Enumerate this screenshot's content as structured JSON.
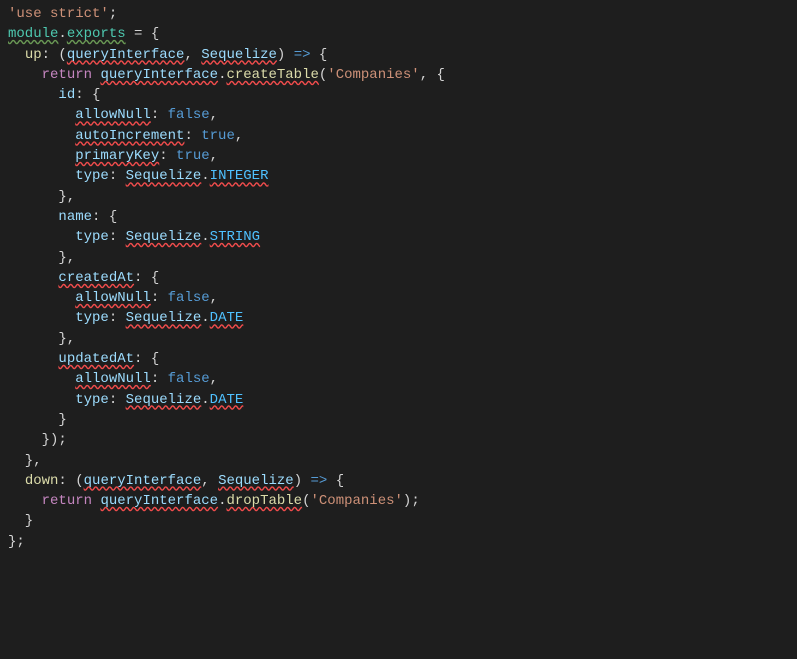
{
  "code": {
    "lines": [
      {
        "tokens": [
          {
            "cls": "string",
            "txt": "'use strict'"
          },
          {
            "cls": "punct",
            "txt": ";"
          }
        ]
      },
      {
        "tokens": [
          {
            "cls": "keyword-export squiggle-green",
            "txt": "module"
          },
          {
            "cls": "punct",
            "txt": "."
          },
          {
            "cls": "keyword-export squiggle-green",
            "txt": "exports"
          },
          {
            "cls": "punct",
            "txt": " = {"
          }
        ]
      },
      {
        "tokens": [
          {
            "cls": "punct",
            "txt": "  "
          },
          {
            "cls": "method",
            "txt": "up"
          },
          {
            "cls": "punct",
            "txt": ": ("
          },
          {
            "cls": "param squiggle-red",
            "txt": "queryInterface"
          },
          {
            "cls": "punct",
            "txt": ", "
          },
          {
            "cls": "param squiggle-red",
            "txt": "Sequelize"
          },
          {
            "cls": "punct",
            "txt": ") "
          },
          {
            "cls": "literal",
            "txt": "=>"
          },
          {
            "cls": "punct",
            "txt": " {"
          }
        ]
      },
      {
        "tokens": [
          {
            "cls": "punct",
            "txt": "    "
          },
          {
            "cls": "keyword-return",
            "txt": "return"
          },
          {
            "cls": "punct",
            "txt": " "
          },
          {
            "cls": "param squiggle-red",
            "txt": "queryInterface"
          },
          {
            "cls": "punct",
            "txt": "."
          },
          {
            "cls": "method squiggle-red",
            "txt": "createTable"
          },
          {
            "cls": "punct",
            "txt": "("
          },
          {
            "cls": "string",
            "txt": "'Companies'"
          },
          {
            "cls": "punct",
            "txt": ", {"
          }
        ]
      },
      {
        "tokens": [
          {
            "cls": "punct",
            "txt": "      "
          },
          {
            "cls": "property",
            "txt": "id"
          },
          {
            "cls": "punct",
            "txt": ": {"
          }
        ]
      },
      {
        "tokens": [
          {
            "cls": "punct",
            "txt": "        "
          },
          {
            "cls": "property squiggle-red",
            "txt": "allowNull"
          },
          {
            "cls": "punct",
            "txt": ": "
          },
          {
            "cls": "literal",
            "txt": "false"
          },
          {
            "cls": "punct",
            "txt": ","
          }
        ]
      },
      {
        "tokens": [
          {
            "cls": "punct",
            "txt": "        "
          },
          {
            "cls": "property squiggle-red",
            "txt": "autoIncrement"
          },
          {
            "cls": "punct",
            "txt": ": "
          },
          {
            "cls": "literal",
            "txt": "true"
          },
          {
            "cls": "punct",
            "txt": ","
          }
        ]
      },
      {
        "tokens": [
          {
            "cls": "punct",
            "txt": "        "
          },
          {
            "cls": "property squiggle-red",
            "txt": "primaryKey"
          },
          {
            "cls": "punct",
            "txt": ": "
          },
          {
            "cls": "literal",
            "txt": "true"
          },
          {
            "cls": "punct",
            "txt": ","
          }
        ]
      },
      {
        "tokens": [
          {
            "cls": "punct",
            "txt": "        "
          },
          {
            "cls": "property",
            "txt": "type"
          },
          {
            "cls": "punct",
            "txt": ": "
          },
          {
            "cls": "param squiggle-red",
            "txt": "Sequelize"
          },
          {
            "cls": "punct",
            "txt": "."
          },
          {
            "cls": "const squiggle-red",
            "txt": "INTEGER"
          }
        ]
      },
      {
        "tokens": [
          {
            "cls": "punct",
            "txt": "      },"
          }
        ]
      },
      {
        "tokens": [
          {
            "cls": "punct",
            "txt": "      "
          },
          {
            "cls": "property",
            "txt": "name"
          },
          {
            "cls": "punct",
            "txt": ": {"
          }
        ]
      },
      {
        "tokens": [
          {
            "cls": "punct",
            "txt": "        "
          },
          {
            "cls": "property",
            "txt": "type"
          },
          {
            "cls": "punct",
            "txt": ": "
          },
          {
            "cls": "param squiggle-red",
            "txt": "Sequelize"
          },
          {
            "cls": "punct",
            "txt": "."
          },
          {
            "cls": "const squiggle-red",
            "txt": "STRING"
          }
        ]
      },
      {
        "tokens": [
          {
            "cls": "punct",
            "txt": "      },"
          }
        ]
      },
      {
        "tokens": [
          {
            "cls": "punct",
            "txt": "      "
          },
          {
            "cls": "property squiggle-red",
            "txt": "createdAt"
          },
          {
            "cls": "punct",
            "txt": ": {"
          }
        ]
      },
      {
        "tokens": [
          {
            "cls": "punct",
            "txt": "        "
          },
          {
            "cls": "property squiggle-red",
            "txt": "allowNull"
          },
          {
            "cls": "punct",
            "txt": ": "
          },
          {
            "cls": "literal",
            "txt": "false"
          },
          {
            "cls": "punct",
            "txt": ","
          }
        ]
      },
      {
        "tokens": [
          {
            "cls": "punct",
            "txt": "        "
          },
          {
            "cls": "property",
            "txt": "type"
          },
          {
            "cls": "punct",
            "txt": ": "
          },
          {
            "cls": "param squiggle-red",
            "txt": "Sequelize"
          },
          {
            "cls": "punct",
            "txt": "."
          },
          {
            "cls": "const squiggle-red",
            "txt": "DATE"
          }
        ]
      },
      {
        "tokens": [
          {
            "cls": "punct",
            "txt": "      },"
          }
        ]
      },
      {
        "tokens": [
          {
            "cls": "punct",
            "txt": "      "
          },
          {
            "cls": "property squiggle-red",
            "txt": "updatedAt"
          },
          {
            "cls": "punct",
            "txt": ": {"
          }
        ]
      },
      {
        "tokens": [
          {
            "cls": "punct",
            "txt": "        "
          },
          {
            "cls": "property squiggle-red",
            "txt": "allowNull"
          },
          {
            "cls": "punct",
            "txt": ": "
          },
          {
            "cls": "literal",
            "txt": "false"
          },
          {
            "cls": "punct",
            "txt": ","
          }
        ]
      },
      {
        "tokens": [
          {
            "cls": "punct",
            "txt": "        "
          },
          {
            "cls": "property",
            "txt": "type"
          },
          {
            "cls": "punct",
            "txt": ": "
          },
          {
            "cls": "param squiggle-red",
            "txt": "Sequelize"
          },
          {
            "cls": "punct",
            "txt": "."
          },
          {
            "cls": "const squiggle-red",
            "txt": "DATE"
          }
        ]
      },
      {
        "tokens": [
          {
            "cls": "punct",
            "txt": "      }"
          }
        ]
      },
      {
        "tokens": [
          {
            "cls": "punct",
            "txt": "    });"
          }
        ]
      },
      {
        "tokens": [
          {
            "cls": "punct",
            "txt": "  },"
          }
        ]
      },
      {
        "tokens": [
          {
            "cls": "punct",
            "txt": "  "
          },
          {
            "cls": "method",
            "txt": "down"
          },
          {
            "cls": "punct",
            "txt": ": ("
          },
          {
            "cls": "param squiggle-red",
            "txt": "queryInterface"
          },
          {
            "cls": "punct",
            "txt": ", "
          },
          {
            "cls": "param squiggle-red",
            "txt": "Sequelize"
          },
          {
            "cls": "punct",
            "txt": ") "
          },
          {
            "cls": "literal",
            "txt": "=>"
          },
          {
            "cls": "punct",
            "txt": " {"
          }
        ]
      },
      {
        "tokens": [
          {
            "cls": "punct",
            "txt": "    "
          },
          {
            "cls": "keyword-return",
            "txt": "return"
          },
          {
            "cls": "punct",
            "txt": " "
          },
          {
            "cls": "param squiggle-red",
            "txt": "queryInterface"
          },
          {
            "cls": "punct",
            "txt": "."
          },
          {
            "cls": "method squiggle-red",
            "txt": "dropTable"
          },
          {
            "cls": "punct",
            "txt": "("
          },
          {
            "cls": "string",
            "txt": "'Companies'"
          },
          {
            "cls": "punct",
            "txt": ");"
          }
        ]
      },
      {
        "tokens": [
          {
            "cls": "punct",
            "txt": "  }"
          }
        ]
      },
      {
        "tokens": [
          {
            "cls": "punct",
            "txt": "};"
          }
        ]
      }
    ]
  }
}
